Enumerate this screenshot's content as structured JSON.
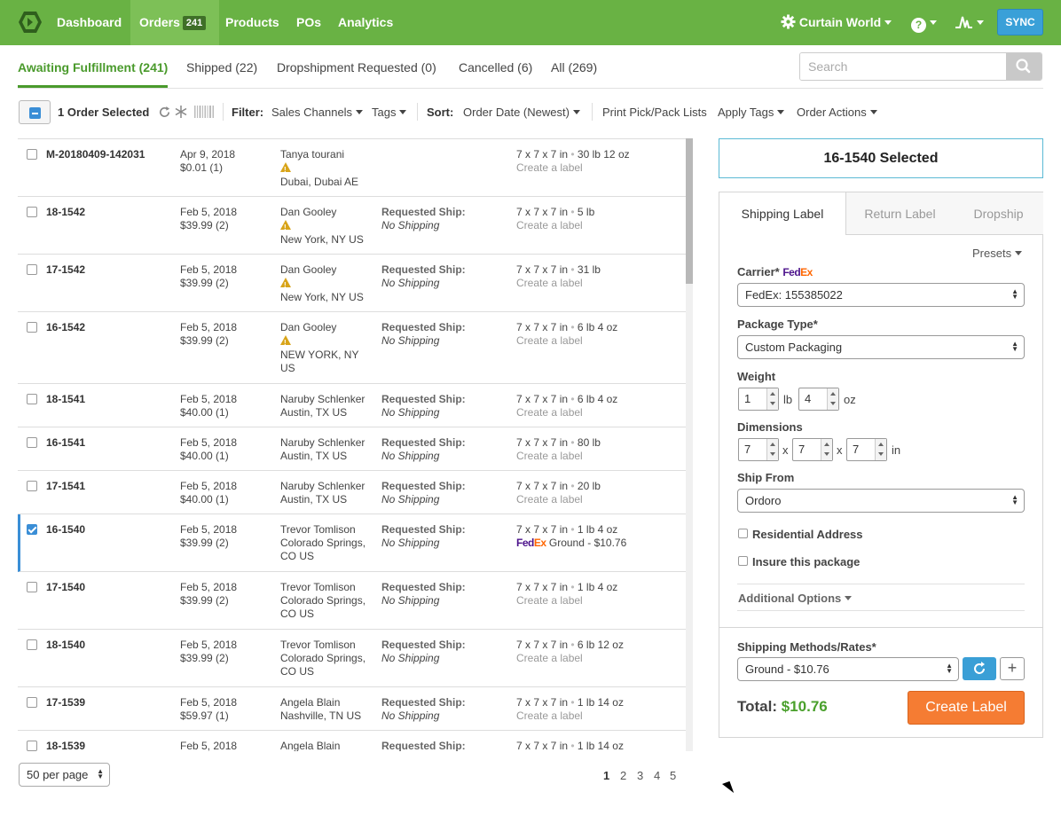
{
  "nav": {
    "items": [
      {
        "label": "Dashboard"
      },
      {
        "label": "Orders",
        "badge": "241"
      },
      {
        "label": "Products"
      },
      {
        "label": "POs"
      },
      {
        "label": "Analytics"
      }
    ],
    "account_label": "Curtain World",
    "help_glyph": "?",
    "sync_label": "SYNC",
    "brand_color": "#69b244"
  },
  "status_tabs": [
    {
      "label": "Awaiting Fulfillment (241)"
    },
    {
      "label": "Shipped (22)"
    },
    {
      "label": "Dropshipment Requested (0)"
    },
    {
      "label": "Cancelled (6)"
    },
    {
      "label": "All (269)"
    }
  ],
  "search": {
    "placeholder": "Search"
  },
  "toolbar": {
    "selected_label": "1 Order Selected",
    "filter_label": "Filter:",
    "sales_channels": "Sales Channels",
    "tags": "Tags",
    "sort_label": "Sort:",
    "sort_value": "Order Date (Newest)",
    "print_lists": "Print Pick/Pack Lists",
    "apply_tags": "Apply Tags",
    "order_actions": "Order Actions"
  },
  "orders": [
    {
      "id": "M-20180409-142031",
      "date": "Apr 9, 2018",
      "amount": "$0.01 (1)",
      "customer": "Tanya tourani",
      "warn": true,
      "location": "Dubai, Dubai AE",
      "req_label": "",
      "req_value": "",
      "package": "7 x 7 x 7 in",
      "weight": "30 lb  12 oz",
      "label_status": "Create a label",
      "checked": false
    },
    {
      "id": "18-1542",
      "date": "Feb 5, 2018",
      "amount": "$39.99 (2)",
      "customer": "Dan Gooley",
      "warn": true,
      "location": "New York, NY US",
      "req_label": "Requested Ship:",
      "req_value": "No Shipping",
      "package": "7 x 7 x 7 in",
      "weight": "5 lb",
      "label_status": "Create a label",
      "checked": false
    },
    {
      "id": "17-1542",
      "date": "Feb 5, 2018",
      "amount": "$39.99 (2)",
      "customer": "Dan Gooley",
      "warn": true,
      "location": "New York, NY US",
      "req_label": "Requested Ship:",
      "req_value": "No Shipping",
      "package": "7 x 7 x 7 in",
      "weight": "31 lb",
      "label_status": "Create a label",
      "checked": false
    },
    {
      "id": "16-1542",
      "date": "Feb 5, 2018",
      "amount": "$39.99 (2)",
      "customer": "Dan Gooley",
      "warn": true,
      "location": "NEW YORK, NY US",
      "req_label": "Requested Ship:",
      "req_value": "No Shipping",
      "package": "7 x 7 x 7 in",
      "weight": "6 lb  4 oz",
      "label_status": "Create a label",
      "checked": false
    },
    {
      "id": "18-1541",
      "date": "Feb 5, 2018",
      "amount": "$40.00 (1)",
      "customer": "Naruby Schlenker",
      "warn": false,
      "location": "Austin, TX US",
      "req_label": "Requested Ship:",
      "req_value": "No Shipping",
      "package": "7 x 7 x 7 in",
      "weight": "6 lb  4 oz",
      "label_status": "Create a label",
      "checked": false
    },
    {
      "id": "16-1541",
      "date": "Feb 5, 2018",
      "amount": "$40.00 (1)",
      "customer": "Naruby Schlenker",
      "warn": false,
      "location": "Austin, TX US",
      "req_label": "Requested Ship:",
      "req_value": "No Shipping",
      "package": "7 x 7 x 7 in",
      "weight": "80 lb",
      "label_status": "Create a label",
      "checked": false
    },
    {
      "id": "17-1541",
      "date": "Feb 5, 2018",
      "amount": "$40.00 (1)",
      "customer": "Naruby Schlenker",
      "warn": false,
      "location": "Austin, TX US",
      "req_label": "Requested Ship:",
      "req_value": "No Shipping",
      "package": "7 x 7 x 7 in",
      "weight": "20 lb",
      "label_status": "Create a label",
      "checked": false
    },
    {
      "id": "16-1540",
      "date": "Feb 5, 2018",
      "amount": "$39.99 (2)",
      "customer": "Trevor Tomlison",
      "warn": false,
      "location": "Colorado Springs, CO US",
      "req_label": "Requested Ship:",
      "req_value": "No Shipping",
      "package": "7 x 7 x 7 in",
      "weight": "1 lb  4 oz",
      "label_status": "Ground - $10.76",
      "fedex": true,
      "checked": true
    },
    {
      "id": "17-1540",
      "date": "Feb 5, 2018",
      "amount": "$39.99 (2)",
      "customer": "Trevor Tomlison",
      "warn": false,
      "location": "Colorado Springs, CO US",
      "req_label": "Requested Ship:",
      "req_value": "No Shipping",
      "package": "7 x 7 x 7 in",
      "weight": "1 lb  4 oz",
      "label_status": "Create a label",
      "checked": false
    },
    {
      "id": "18-1540",
      "date": "Feb 5, 2018",
      "amount": "$39.99 (2)",
      "customer": "Trevor Tomlison",
      "warn": false,
      "location": "Colorado Springs, CO US",
      "req_label": "Requested Ship:",
      "req_value": "No Shipping",
      "package": "7 x 7 x 7 in",
      "weight": "6 lb  12 oz",
      "label_status": "Create a label",
      "checked": false
    },
    {
      "id": "17-1539",
      "date": "Feb 5, 2018",
      "amount": "$59.97 (1)",
      "customer": "Angela Blain",
      "warn": false,
      "location": "Nashville, TN US",
      "req_label": "Requested Ship:",
      "req_value": "No Shipping",
      "package": "7 x 7 x 7 in",
      "weight": "1 lb  14 oz",
      "label_status": "Create a label",
      "checked": false
    },
    {
      "id": "18-1539",
      "date": "Feb 5, 2018",
      "amount": "",
      "customer": "Angela Blain",
      "warn": false,
      "location": "",
      "req_label": "Requested Ship:",
      "req_value": "",
      "package": "7 x 7 x 7 in",
      "weight": "1 lb  14 oz",
      "label_status": "",
      "checked": false
    }
  ],
  "pagination": {
    "per_page": "50 per page",
    "pages": [
      "1",
      "2",
      "3",
      "4",
      "5"
    ],
    "current": "1"
  },
  "panel": {
    "selected_title": "16-1540 Selected",
    "tabs": [
      "Shipping Label",
      "Return Label",
      "Dropship"
    ],
    "presets": "Presets",
    "carrier_label": "Carrier*",
    "carrier_brand_fe": "Fed",
    "carrier_brand_ex": "Ex",
    "carrier_value": "FedEx: 155385022",
    "package_type_label": "Package Type*",
    "package_type_value": "Custom Packaging",
    "weight_label": "Weight",
    "weight_lb": "1",
    "weight_lb_unit": "lb",
    "weight_oz": "4",
    "weight_oz_unit": "oz",
    "dimensions_label": "Dimensions",
    "dim_l": "7",
    "dim_w": "7",
    "dim_h": "7",
    "dim_sep": "x",
    "dim_unit": "in",
    "ship_from_label": "Ship From",
    "ship_from_value": "Ordoro",
    "residential_label": "Residential Address",
    "insure_label": "Insure this package",
    "additional_options": "Additional Options",
    "methods_label": "Shipping Methods/Rates*",
    "method_value": "Ground - $10.76",
    "plus_glyph": "+",
    "total_label": "Total:",
    "total_value": "$10.76",
    "create_label": "Create Label"
  }
}
